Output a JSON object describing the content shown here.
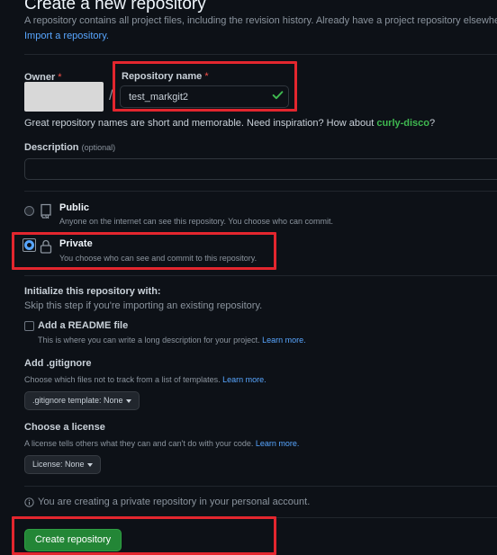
{
  "header": {
    "title": "Create a new repository",
    "intro": "A repository contains all project files, including the revision history. Already have a project repository elsewhere?",
    "import_link": "Import a repository."
  },
  "owner": {
    "label": "Owner",
    "required_mark": "*"
  },
  "repo_name": {
    "label": "Repository name",
    "required_mark": "*",
    "value": "test_markgit2",
    "separator": "/"
  },
  "name_hint": {
    "text": "Great repository names are short and memorable. Need inspiration? How about",
    "suggestion": "curly-disco",
    "end": "?"
  },
  "description": {
    "label": "Description",
    "optional": "(optional)",
    "value": ""
  },
  "visibility": {
    "public": {
      "title": "Public",
      "desc": "Anyone on the internet can see this repository. You choose who can commit.",
      "selected": false
    },
    "private": {
      "title": "Private",
      "desc": "You choose who can see and commit to this repository.",
      "selected": true
    }
  },
  "init": {
    "title": "Initialize this repository with:",
    "subtitle": "Skip this step if you're importing an existing repository.",
    "readme_label": "Add a README file",
    "readme_desc": "This is where you can write a long description for your project.",
    "learn_more": "Learn more."
  },
  "gitignore": {
    "title": "Add .gitignore",
    "desc": "Choose which files not to track from a list of templates.",
    "learn_more": "Learn more.",
    "button": ".gitignore template: None"
  },
  "license": {
    "title": "Choose a license",
    "desc": "A license tells others what they can and can't do with your code.",
    "learn_more": "Learn more.",
    "button": "License: None"
  },
  "notice": {
    "text": "You are creating a private repository in your personal account."
  },
  "submit": {
    "label": "Create repository"
  },
  "colors": {
    "accent": "#58a6ff",
    "success": "#238636",
    "annotation": "#e3262e",
    "background": "#0d1117"
  }
}
